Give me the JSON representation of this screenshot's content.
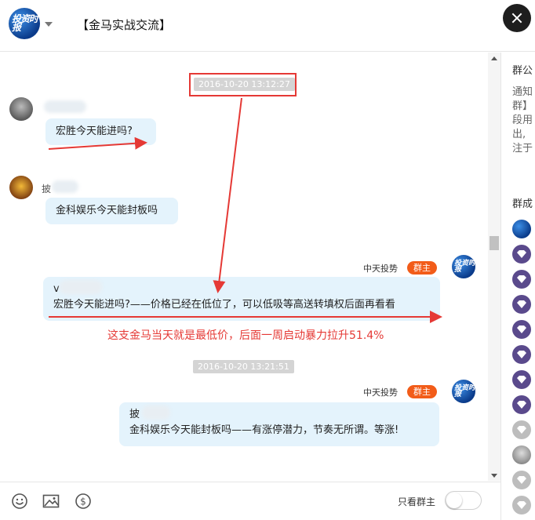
{
  "header": {
    "logo_text": "投资时报",
    "title": "【金马实战交流】"
  },
  "chat": {
    "timestamps": [
      "2016-10-20 13:12:27",
      "2016-10-20 13:21:51"
    ],
    "messages": [
      {
        "name_char": "",
        "text": "宏胜今天能进吗?"
      },
      {
        "name_char": "披",
        "text": "金科娱乐今天能封板吗"
      },
      {
        "sender": "中天投势",
        "badge": "群主",
        "quote_char": "v",
        "text": "宏胜今天能进吗?——价格已经在低位了，可以低吸等高送转填权后面再看看"
      },
      {
        "sender": "中天投势",
        "badge": "群主",
        "quote_char": "披",
        "text": "金科娱乐今天能封板吗——有涨停潜力，节奏无所谓。等涨!"
      }
    ],
    "annotation": "这支金马当天就是最低价，后面一周启动暴力拉升51.4%",
    "annotation_color": "#e53935"
  },
  "toolbar": {
    "only_owner_label": "只看群主",
    "icons": [
      "emoji-icon",
      "image-icon",
      "dollar-icon"
    ]
  },
  "sidebar": {
    "notice_heading": "群公",
    "notice_lines": [
      "通知",
      "群】",
      "段用",
      "出,",
      "注于"
    ],
    "members_heading": "群成"
  },
  "colors": {
    "bubble": "#e4f3fc",
    "badge": "#f25c19",
    "member_purple": "#5a4a8c"
  }
}
